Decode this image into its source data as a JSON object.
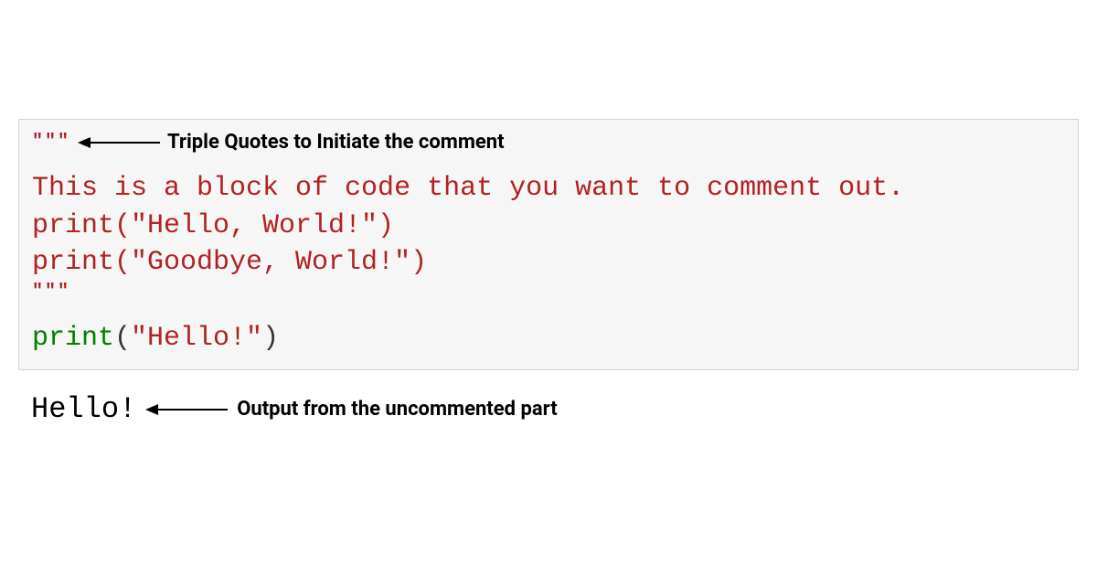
{
  "code": {
    "triple_open": "\"\"\"",
    "comment_line1": "This is a block of code that you want to comment out.",
    "comment_line2": "print(\"Hello, World!\")",
    "comment_line3": "print(\"Goodbye, World!\")",
    "triple_close": "\"\"\"",
    "exec_fn": "print",
    "exec_paren_open": "(",
    "exec_str": "\"Hello!\"",
    "exec_paren_close": ")"
  },
  "annotations": {
    "top_label": "Triple Quotes to Initiate the comment",
    "bottom_label": "Output from the uncommented part"
  },
  "output": {
    "text": "Hello!"
  }
}
